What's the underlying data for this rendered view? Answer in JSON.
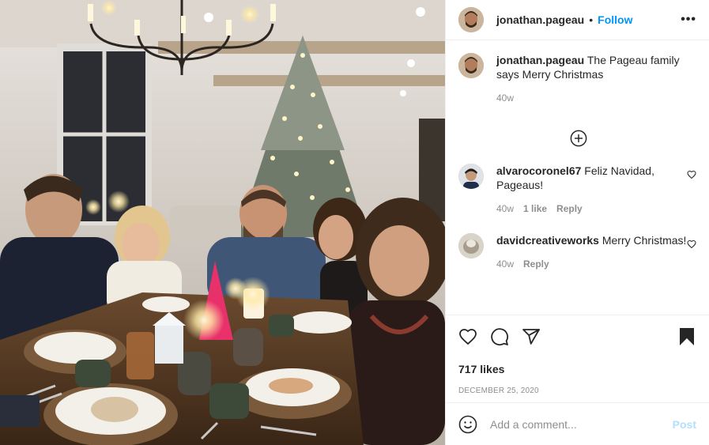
{
  "post": {
    "username": "jonathan.pageau",
    "dot": "•",
    "follow_label": "Follow",
    "more_label": "•••",
    "caption": "The Pageau family says Merry Christmas",
    "caption_age": "40w",
    "likes": "717 likes",
    "date": "DECEMBER 25, 2020",
    "photo_alt": "Family seated around a candlelit dinner table in front of a lit Christmas tree"
  },
  "comments": [
    {
      "username": "alvarocoronel67",
      "text": "Feliz Navidad, Pageaus!",
      "age": "40w",
      "likes": "1 like",
      "reply": "Reply"
    },
    {
      "username": "davidcreativeworks",
      "text": "Merry Christmas!",
      "age": "40w",
      "reply": "Reply"
    }
  ],
  "add_comment": {
    "placeholder": "Add a comment...",
    "post_label": "Post"
  },
  "icons": {
    "like": "heart-icon",
    "comment": "comment-icon",
    "share": "share-icon",
    "save": "bookmark-icon",
    "emoji": "emoji-icon",
    "load_more": "plus-circle-icon"
  },
  "colors": {
    "follow": "#0095f6",
    "post_disabled": "#b2dffc",
    "muted": "#8e8e8e",
    "text": "#262626"
  }
}
